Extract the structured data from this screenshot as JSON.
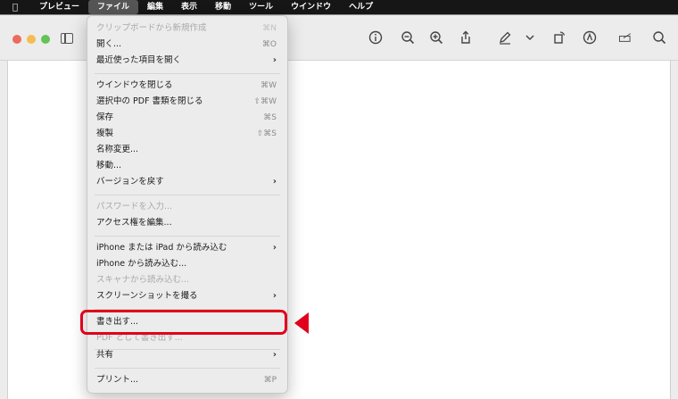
{
  "menubar": {
    "app": "プレビュー",
    "items": [
      "ファイル",
      "編集",
      "表示",
      "移動",
      "ツール",
      "ウインドウ",
      "ヘルプ"
    ]
  },
  "menu": {
    "items": [
      {
        "label": "クリップボードから新規作成",
        "shortcut": "⌘N",
        "disabled": true
      },
      {
        "label": "開く...",
        "shortcut": "⌘O"
      },
      {
        "label": "最近使った項目を開く",
        "submenu": true
      },
      {
        "label": "ウインドウを閉じる",
        "shortcut": "⌘W"
      },
      {
        "label": "選択中の PDF 書類を閉じる",
        "shortcut": "⇧⌘W"
      },
      {
        "label": "保存",
        "shortcut": "⌘S"
      },
      {
        "label": "複製",
        "shortcut": "⇧⌘S"
      },
      {
        "label": "名称変更..."
      },
      {
        "label": "移動..."
      },
      {
        "label": "バージョンを戻す",
        "submenu": true
      },
      {
        "label": "パスワードを入力...",
        "disabled": true
      },
      {
        "label": "アクセス権を編集..."
      },
      {
        "label": "iPhone または iPad から読み込む",
        "submenu": true
      },
      {
        "label": "iPhone から読み込む..."
      },
      {
        "label": "スキャナから読み込む...",
        "disabled": true
      },
      {
        "label": "スクリーンショットを撮る",
        "submenu": true
      },
      {
        "label": "書き出す..."
      },
      {
        "label": "PDF として書き出す...",
        "disabled": true
      },
      {
        "label": "共有",
        "submenu": true
      },
      {
        "label": "プリント...",
        "shortcut": "⌘P"
      }
    ]
  },
  "toolbar": {
    "icons": [
      "info-icon",
      "zoom-out-icon",
      "zoom-in-icon",
      "share-icon",
      "markup-pen-icon",
      "chevron-down-icon",
      "rotate-icon",
      "markup-icon",
      "sign-icon",
      "search-icon"
    ]
  },
  "accent": "#e0001b"
}
